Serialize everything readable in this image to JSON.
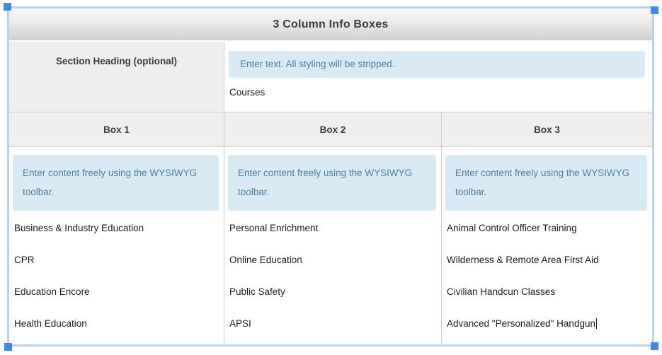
{
  "widget": {
    "title": "3 Column Info Boxes",
    "section": {
      "label": "Section Heading (optional)",
      "placeholder": "Enter text. All styling will be stripped.",
      "value": "Courses"
    },
    "content_placeholder": "Enter content freely using the WYSIWYG toolbar.",
    "boxes": [
      {
        "label": "Box 1",
        "items": [
          "Business & Industry Education",
          "CPR",
          "Education Encore",
          "Health Education"
        ]
      },
      {
        "label": "Box 2",
        "items": [
          "Personal Enrichment",
          "Online Education",
          "Public Safety",
          "APSI"
        ]
      },
      {
        "label": "Box 3",
        "items": [
          "Animal Control Officer Training",
          "Wilderness & Remote Area First Aid",
          "Civilian Handcun Classes",
          "Advanced \"Personalized\" Handgun"
        ]
      }
    ]
  },
  "selection": {
    "border_color": "#b9d1f0",
    "handle_color": "#4187f1"
  },
  "colors": {
    "header_gradient_top": "#f9f8f7",
    "header_gradient_bottom": "#d2d0cf",
    "cell_gray": "#f0eeed",
    "placeholder_bg": "#d9eaf4",
    "placeholder_text": "#4d7fa3",
    "grid_line": "#cfcdcc",
    "heading_text": "#3c3c3c",
    "body_text": "#1c1c1c"
  }
}
